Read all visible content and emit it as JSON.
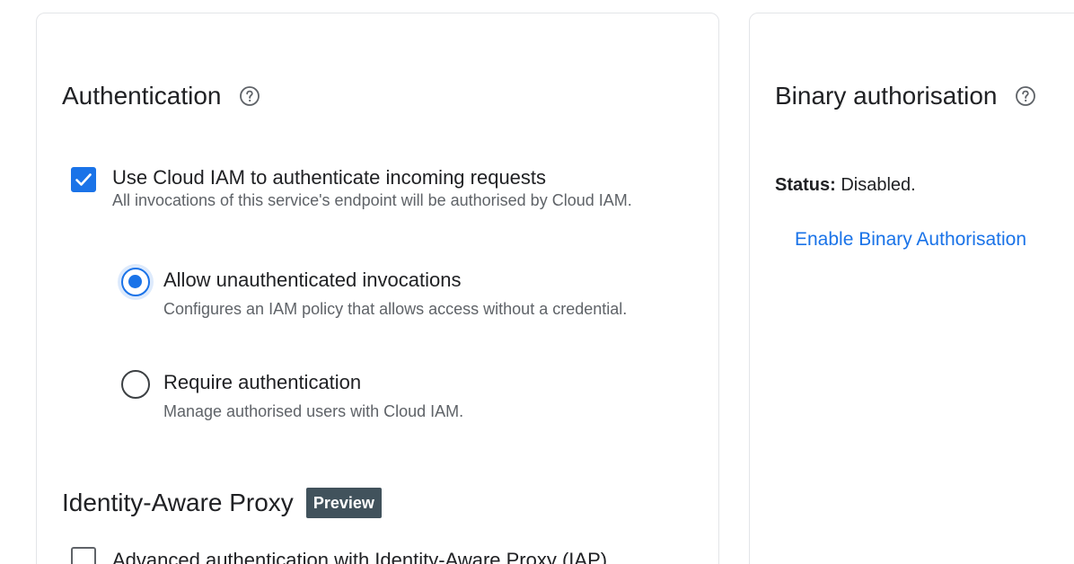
{
  "authentication": {
    "title": "Authentication",
    "cloud_iam": {
      "label": "Use Cloud IAM to authenticate incoming requests",
      "description": "All invocations of this service's endpoint will be authorised by Cloud IAM.",
      "checked": true
    },
    "options": [
      {
        "label": "Allow unauthenticated invocations",
        "description": "Configures an IAM policy that allows access without a credential.",
        "selected": true
      },
      {
        "label": "Require authentication",
        "description": "Manage authorised users with Cloud IAM.",
        "selected": false
      }
    ]
  },
  "iap": {
    "title": "Identity-Aware Proxy",
    "badge": "Preview",
    "checkbox_label": "Advanced authentication with Identity-Aware Proxy (IAP)",
    "checked": false
  },
  "binary_authorisation": {
    "title": "Binary authorisation",
    "status_label": "Status:",
    "status_value": "Disabled.",
    "enable_link": "Enable Binary Authorisation"
  },
  "colors": {
    "accent": "#1a73e8",
    "badge_bg": "#41525c",
    "secondary_text": "#5f6368"
  },
  "icons": {
    "help": "help-circle-icon",
    "check": "checkmark-icon"
  }
}
